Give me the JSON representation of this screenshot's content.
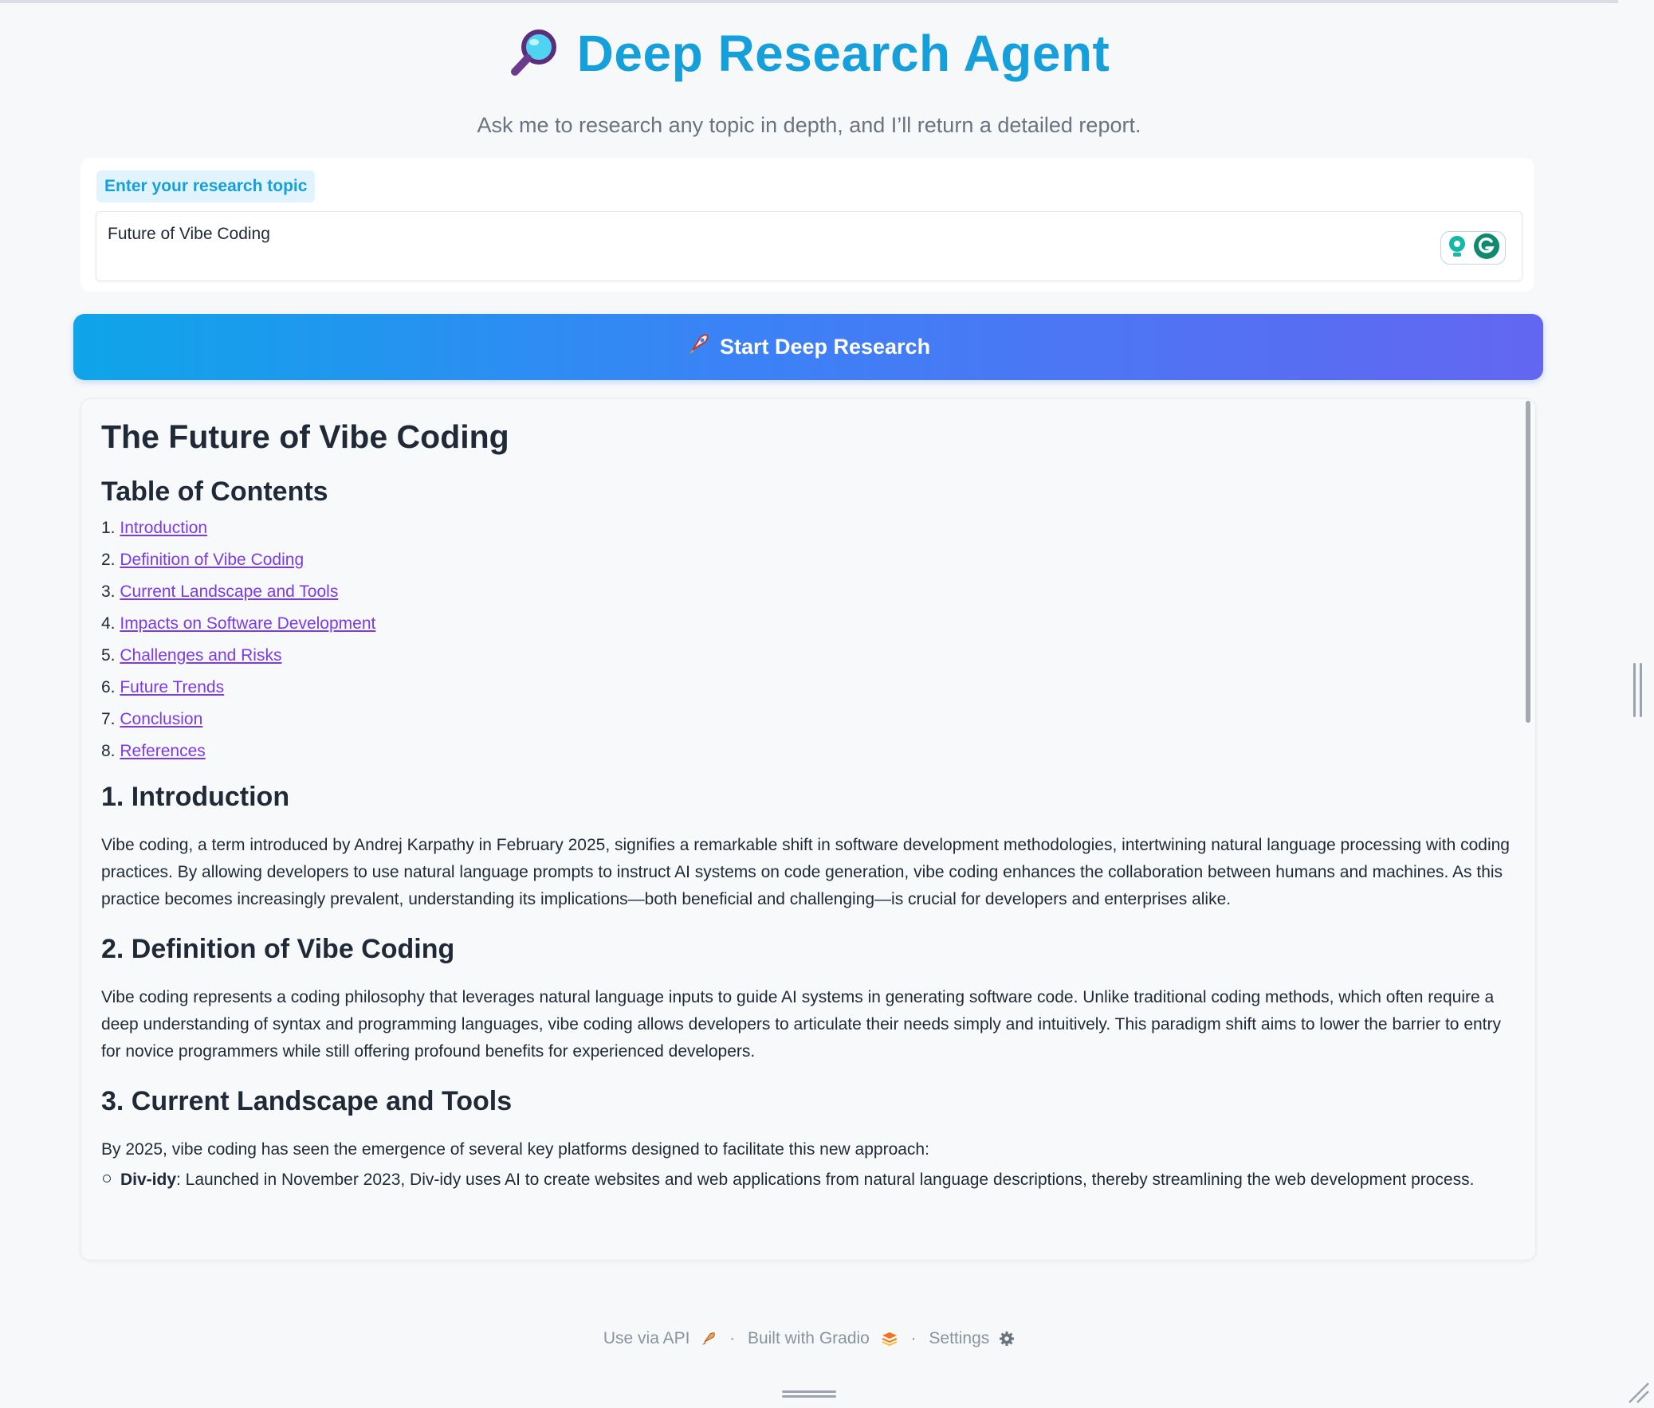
{
  "header": {
    "title": "Deep Research Agent",
    "subtitle": "Ask me to research any topic in depth, and I’ll return a detailed report.",
    "icon": "magnifier-icon"
  },
  "input": {
    "label": "Enter your research topic",
    "value": "Future of Vibe Coding"
  },
  "start_button": {
    "label": "Start Deep Research",
    "icon": "rocket-icon"
  },
  "report": {
    "title": "The Future of Vibe Coding",
    "toc_heading": "Table of Contents",
    "toc": [
      {
        "num": "1.",
        "label": "Introduction"
      },
      {
        "num": "2.",
        "label": "Definition of Vibe Coding"
      },
      {
        "num": "3.",
        "label": "Current Landscape and Tools"
      },
      {
        "num": "4.",
        "label": "Impacts on Software Development"
      },
      {
        "num": "5.",
        "label": "Challenges and Risks"
      },
      {
        "num": "6.",
        "label": "Future Trends"
      },
      {
        "num": "7.",
        "label": "Conclusion"
      },
      {
        "num": "8.",
        "label": "References"
      }
    ],
    "sections": [
      {
        "heading": "1. Introduction",
        "body": "Vibe coding, a term introduced by Andrej Karpathy in February 2025, signifies a remarkable shift in software development methodologies, intertwining natural language processing with coding practices. By allowing developers to use natural language prompts to instruct AI systems on code generation, vibe coding enhances the collaboration between humans and machines. As this practice becomes increasingly prevalent, understanding its implications—both beneficial and challenging—is crucial for developers and enterprises alike."
      },
      {
        "heading": "2. Definition of Vibe Coding",
        "body": "Vibe coding represents a coding philosophy that leverages natural language inputs to guide AI systems in generating software code. Unlike traditional coding methods, which often require a deep understanding of syntax and programming languages, vibe coding allows developers to articulate their needs simply and intuitively. This paradigm shift aims to lower the barrier to entry for novice programmers while still offering profound benefits for experienced developers."
      },
      {
        "heading": "3. Current Landscape and Tools",
        "body": "By 2025, vibe coding has seen the emergence of several key platforms designed to facilitate this new approach:",
        "bullet_bold": "Div-idy",
        "bullet_text": ": Launched in November 2023, Div-idy uses AI to create websites and web applications from natural language descriptions, thereby streamlining the web development process."
      }
    ]
  },
  "footer": {
    "api": "Use via API",
    "gradio": "Built with Gradio",
    "settings": "Settings",
    "separator": "·"
  },
  "colors": {
    "accent": "#159fdb",
    "link": "#7c3aed",
    "button_start": "#0ea5e9",
    "button_end": "#6366f1"
  }
}
